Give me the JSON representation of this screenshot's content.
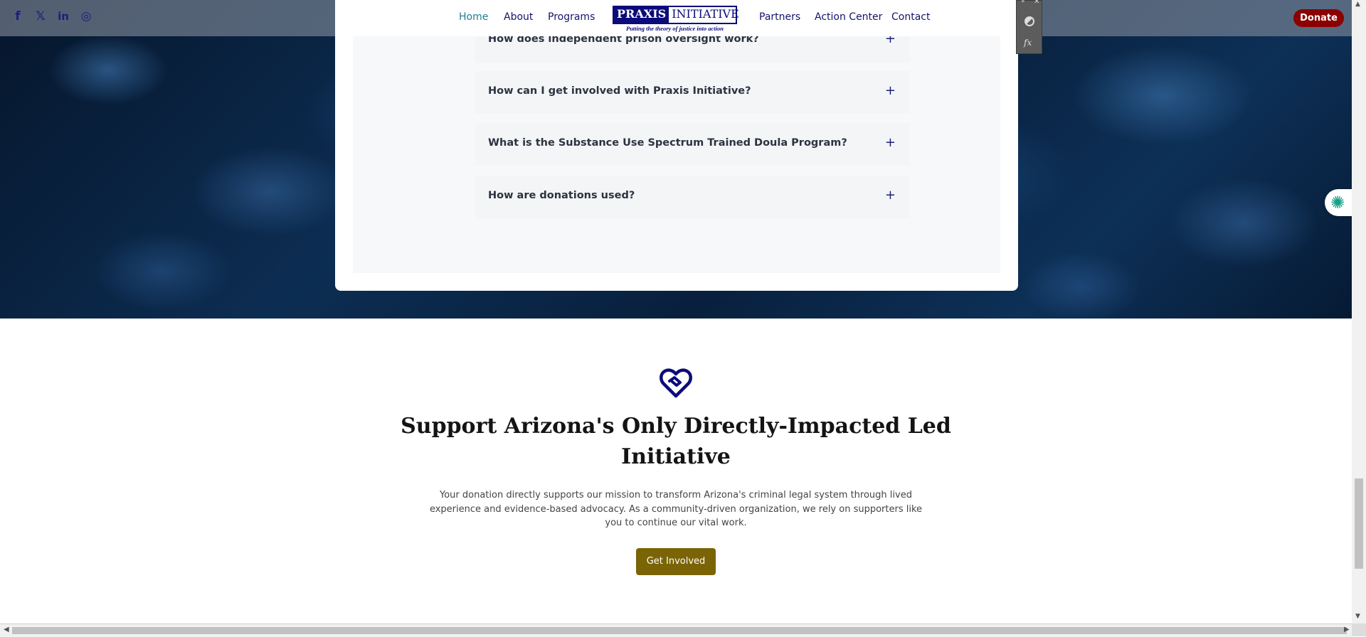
{
  "header": {
    "social": [
      {
        "icon": "facebook-icon",
        "glyph": "f"
      },
      {
        "icon": "x-twitter-icon",
        "glyph": "𝕏"
      },
      {
        "icon": "linkedin-icon",
        "glyph": "in"
      },
      {
        "icon": "instagram-icon",
        "glyph": "◎"
      }
    ],
    "nav_left": [
      "Home",
      "About",
      "Programs"
    ],
    "nav_right": [
      "Partners",
      "Action Center",
      "Contact"
    ],
    "active": "Home",
    "logo": {
      "word1": "PRAXIS",
      "word2": "INITIATIVE",
      "tagline": "Putting the theory of justice into action"
    },
    "donate_label": "Donate"
  },
  "faq": {
    "items": [
      "How does independent prison oversight work?",
      "How can I get involved with Praxis Initiative?",
      "What is the Substance Use Spectrum Trained Doula Program?",
      "How are donations used?"
    ],
    "expand_glyph": "+"
  },
  "support": {
    "icon": "heart-handshake-icon",
    "title": "Support Arizona's Only Directly-Impacted Led Initiative",
    "description": "Your donation directly supports our mission to transform Arizona's criminal legal system through lived experience and evidence-based advocacy. As a community-driven organization, we rely on supporters like you to continue our vital work.",
    "button_label": "Get Involved"
  },
  "colors": {
    "brand_navy": "#0b0b7a",
    "nav_active": "#1a7f93",
    "donate_red": "#8b0000",
    "cta_gold": "#7a6405"
  }
}
